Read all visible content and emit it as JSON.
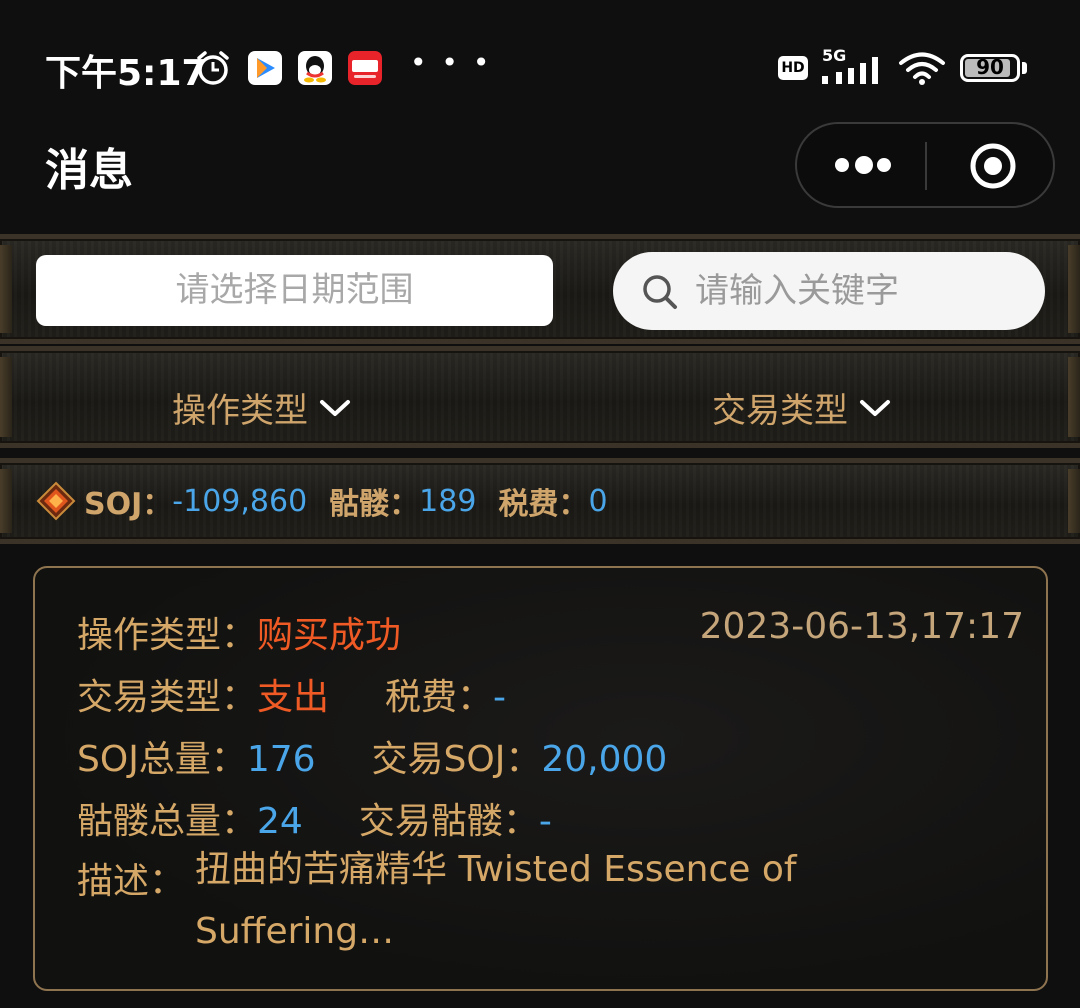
{
  "status_bar": {
    "time": "下午5:17",
    "hd": "HD",
    "network": "5G",
    "battery": "90",
    "battery_level": 0.9,
    "more": "• • •",
    "icons": [
      "alarm-icon",
      "video-app-icon",
      "qq-icon",
      "kandian-icon",
      "signal-icon",
      "wifi-icon",
      "battery-icon"
    ]
  },
  "header": {
    "title": "消息",
    "capsule_icons": [
      "more-icon",
      "close-miniprogram-icon"
    ]
  },
  "filters": {
    "date_placeholder": "请选择日期范围",
    "search_placeholder": "请输入关键字",
    "operation_type": "操作类型",
    "transaction_type": "交易类型"
  },
  "summary": {
    "soj_label": "SOJ：",
    "soj_value": "-109,860",
    "skull_label": "骷髅：",
    "skull_value": "189",
    "tax_label": "税费：",
    "tax_value": "0"
  },
  "record": {
    "op_label": "操作类型：",
    "op_value": "购买成功",
    "datetime": "2023-06-13,17:17",
    "tx_label": "交易类型：",
    "tx_value": "支出",
    "tax_label": "税费：",
    "tax_value": "-",
    "soj_total_label": "SOJ总量：",
    "soj_total_value": "176",
    "tx_soj_label": "交易SOJ：",
    "tx_soj_value": "20,000",
    "skull_total_label": "骷髅总量：",
    "skull_total_value": "24",
    "tx_skull_label": "交易骷髅：",
    "tx_skull_value": "-",
    "desc_label": "描述：",
    "desc_value": "扭曲的苦痛精华 Twisted Essence of Suffering…"
  },
  "colors": {
    "gold": "#d6a868",
    "red": "#f05a24",
    "blue": "#4aa6e8",
    "card_border": "#8f7450"
  }
}
